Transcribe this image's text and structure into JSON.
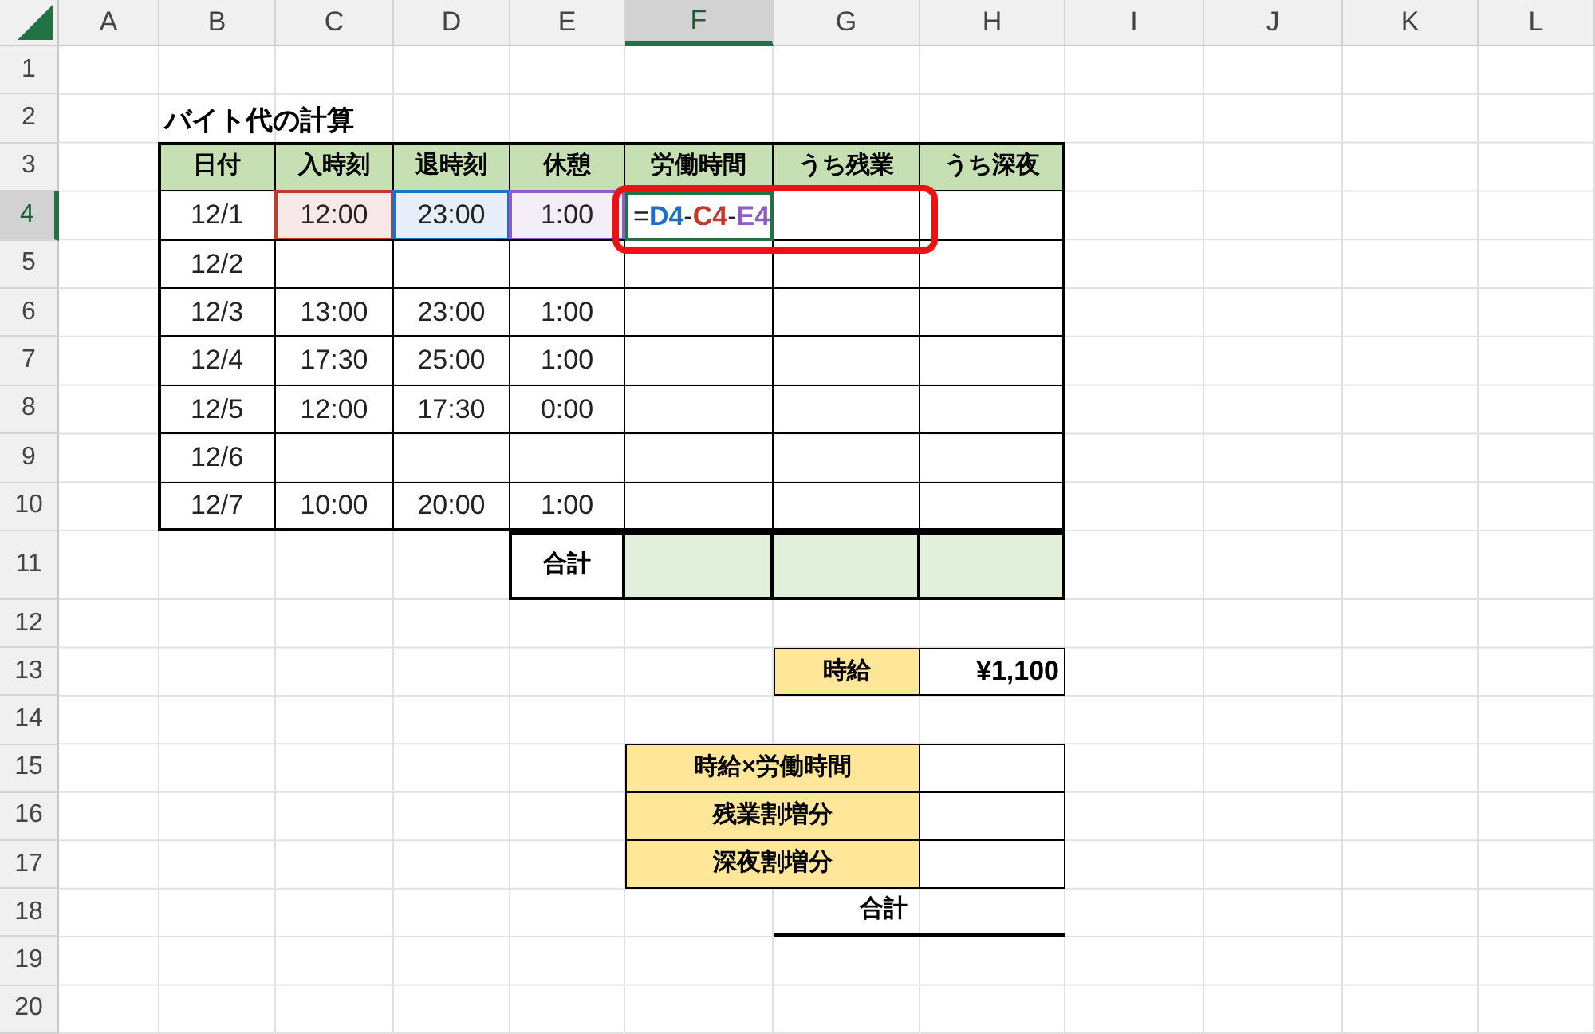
{
  "column_headers": [
    {
      "label": "A",
      "selected": false
    },
    {
      "label": "B",
      "selected": false
    },
    {
      "label": "C",
      "selected": false
    },
    {
      "label": "D",
      "selected": false
    },
    {
      "label": "E",
      "selected": false
    },
    {
      "label": "F",
      "selected": true
    },
    {
      "label": "G",
      "selected": false
    },
    {
      "label": "H",
      "selected": false
    },
    {
      "label": "I",
      "selected": false
    },
    {
      "label": "J",
      "selected": false
    },
    {
      "label": "K",
      "selected": false
    },
    {
      "label": "L",
      "selected": false
    }
  ],
  "row_headers": [
    {
      "label": "1",
      "selected": false
    },
    {
      "label": "2",
      "selected": false
    },
    {
      "label": "3",
      "selected": false
    },
    {
      "label": "4",
      "selected": true
    },
    {
      "label": "5",
      "selected": false
    },
    {
      "label": "6",
      "selected": false
    },
    {
      "label": "7",
      "selected": false
    },
    {
      "label": "8",
      "selected": false
    },
    {
      "label": "9",
      "selected": false
    },
    {
      "label": "10",
      "selected": false
    },
    {
      "label": "11",
      "selected": false
    },
    {
      "label": "12",
      "selected": false
    },
    {
      "label": "13",
      "selected": false
    },
    {
      "label": "14",
      "selected": false
    },
    {
      "label": "15",
      "selected": false
    },
    {
      "label": "16",
      "selected": false
    },
    {
      "label": "17",
      "selected": false
    },
    {
      "label": "18",
      "selected": false
    },
    {
      "label": "19",
      "selected": false
    },
    {
      "label": "20",
      "selected": false
    }
  ],
  "title": "バイト代の計算",
  "table": {
    "columns": [
      "日付",
      "入時刻",
      "退時刻",
      "休憩",
      "労働時間",
      "うち残業",
      "うち深夜"
    ],
    "rows": [
      {
        "cells": [
          "12/1",
          {
            "text": "12:00",
            "color": "#c0392b"
          },
          {
            "text": "23:00",
            "color": "#1f6fc5"
          },
          {
            "text": "1:00",
            "color": "#8e5cc2"
          },
          null,
          null,
          null
        ],
        "formula": [
          {
            "text": "=",
            "color": "#222222"
          },
          {
            "text": "D4",
            "color": "#1f6fc5"
          },
          {
            "text": "-",
            "color": "#222222"
          },
          {
            "text": "C4",
            "color": "#c0392b"
          },
          {
            "text": "-",
            "color": "#222222"
          },
          {
            "text": "E4",
            "color": "#8e5cc2"
          }
        ]
      },
      {
        "cells": [
          "12/2",
          null,
          null,
          null,
          null,
          null,
          null
        ]
      },
      {
        "cells": [
          "12/3",
          "13:00",
          "23:00",
          "1:00",
          null,
          null,
          null
        ]
      },
      {
        "cells": [
          "12/4",
          "17:30",
          "25:00",
          "1:00",
          null,
          null,
          null
        ]
      },
      {
        "cells": [
          "12/5",
          "12:00",
          "17:30",
          "0:00",
          null,
          null,
          null
        ]
      },
      {
        "cells": [
          "12/6",
          null,
          null,
          null,
          null,
          null,
          null
        ]
      },
      {
        "cells": [
          "12/7",
          "10:00",
          "20:00",
          "1:00",
          null,
          null,
          null
        ]
      }
    ],
    "total_label": "合計"
  },
  "wage": {
    "label": "時給",
    "value": "¥1,100"
  },
  "breakdown": {
    "items": [
      "時給×労働時間",
      "残業割増分",
      "深夜割増分"
    ],
    "total_label": "合計"
  }
}
